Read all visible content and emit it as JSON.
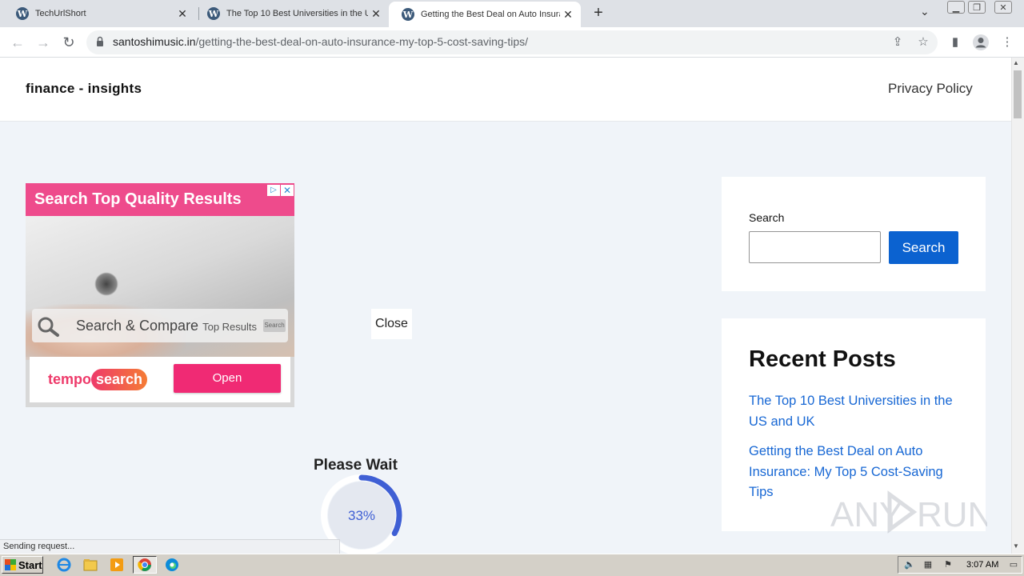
{
  "browser": {
    "tabs": [
      {
        "title": "TechUrlShort",
        "active": false
      },
      {
        "title": "The Top 10 Best Universities in the U",
        "active": false
      },
      {
        "title": "Getting the Best Deal on Auto Insura",
        "active": true
      }
    ],
    "url_domain": "santoshimusic.in",
    "url_path": "/getting-the-best-deal-on-auto-insurance-my-top-5-cost-saving-tips/"
  },
  "site": {
    "title": "finance - insights",
    "nav_privacy": "Privacy Policy"
  },
  "ad": {
    "headline": "Search Top Quality Results",
    "bar_text_large": "Search & Compare",
    "bar_text_small": "Top Results",
    "bar_button": "Search",
    "logo_part1": "tempo",
    "logo_part2": "search",
    "open_label": "Open"
  },
  "overlay": {
    "close_label": "Close",
    "wait_label": "Please Wait",
    "progress_text": "33%",
    "progress": 0.33
  },
  "sidebar": {
    "search_label": "Search",
    "search_value": "",
    "search_button": "Search",
    "recent_title": "Recent Posts",
    "recent_posts": [
      "The Top 10 Best Universities in the US and UK",
      "Getting the Best Deal on Auto Insurance: My Top 5 Cost-Saving Tips"
    ]
  },
  "status_text": "Sending request...",
  "watermark": {
    "left": "ANY",
    "right": "RUN"
  },
  "taskbar": {
    "start_label": "Start",
    "clock": "3:07 AM"
  },
  "colors": {
    "accent_button": "#0b62d0",
    "link": "#1767d4",
    "ad_pink": "#ee4b8c",
    "progress_arc": "#3f5fd4"
  }
}
